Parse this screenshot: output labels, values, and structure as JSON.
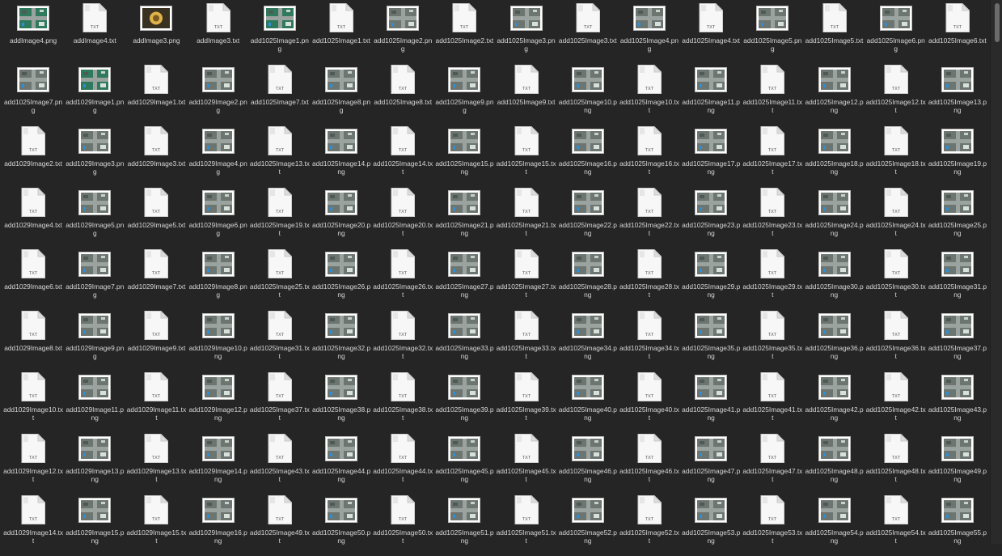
{
  "window": {
    "view": "icon-grid"
  },
  "colors": {
    "background": "#252525",
    "label": "#d6d6d6",
    "txt_badge": "#ffffff"
  },
  "icons": {
    "png": "image-file-icon",
    "txt": "text-file-icon",
    "txt_badge": "TXT"
  },
  "files": [
    {
      "label": "addImage4.png",
      "type": "png"
    },
    {
      "label": "addImage4.txt",
      "type": "txt"
    },
    {
      "label": "addImage3.png",
      "type": "png"
    },
    {
      "label": "addImage3.txt",
      "type": "txt"
    },
    {
      "label": "add1025Image1.png",
      "type": "png"
    },
    {
      "label": "add1025Image1.txt",
      "type": "txt"
    },
    {
      "label": "add1025Image2.png",
      "type": "png"
    },
    {
      "label": "add1025Image2.txt",
      "type": "txt"
    },
    {
      "label": "add1025Image3.png",
      "type": "png"
    },
    {
      "label": "add1025Image3.txt",
      "type": "txt"
    },
    {
      "label": "add1025Image4.png",
      "type": "png"
    },
    {
      "label": "add1025Image4.txt",
      "type": "txt"
    },
    {
      "label": "add1025Image5.png",
      "type": "png"
    },
    {
      "label": "add1025Image5.txt",
      "type": "txt"
    },
    {
      "label": "add1025Image6.png",
      "type": "png"
    },
    {
      "label": "add1025Image6.txt",
      "type": "txt"
    },
    {
      "label": "add1025Image7.png",
      "type": "png"
    },
    {
      "label": "add1029Image1.png",
      "type": "png"
    },
    {
      "label": "add1029Image1.txt",
      "type": "txt"
    },
    {
      "label": "add1029Image2.png",
      "type": "png"
    },
    {
      "label": "add1025Image7.txt",
      "type": "txt"
    },
    {
      "label": "add1025Image8.png",
      "type": "png"
    },
    {
      "label": "add1025Image8.txt",
      "type": "txt"
    },
    {
      "label": "add1025Image9.png",
      "type": "png"
    },
    {
      "label": "add1025Image9.txt",
      "type": "txt"
    },
    {
      "label": "add1025Image10.png",
      "type": "png"
    },
    {
      "label": "add1025Image10.txt",
      "type": "txt"
    },
    {
      "label": "add1025Image11.png",
      "type": "png"
    },
    {
      "label": "add1025Image11.txt",
      "type": "txt"
    },
    {
      "label": "add1025Image12.png",
      "type": "png"
    },
    {
      "label": "add1025Image12.txt",
      "type": "txt"
    },
    {
      "label": "add1025Image13.png",
      "type": "png"
    },
    {
      "label": "add1029Image2.txt",
      "type": "txt"
    },
    {
      "label": "add1029Image3.png",
      "type": "png"
    },
    {
      "label": "add1029Image3.txt",
      "type": "txt"
    },
    {
      "label": "add1029Image4.png",
      "type": "png"
    },
    {
      "label": "add1025Image13.txt",
      "type": "txt"
    },
    {
      "label": "add1025Image14.png",
      "type": "png"
    },
    {
      "label": "add1025Image14.txt",
      "type": "txt"
    },
    {
      "label": "add1025Image15.png",
      "type": "png"
    },
    {
      "label": "add1025Image15.txt",
      "type": "txt"
    },
    {
      "label": "add1025Image16.png",
      "type": "png"
    },
    {
      "label": "add1025Image16.txt",
      "type": "txt"
    },
    {
      "label": "add1025Image17.png",
      "type": "png"
    },
    {
      "label": "add1025Image17.txt",
      "type": "txt"
    },
    {
      "label": "add1025Image18.png",
      "type": "png"
    },
    {
      "label": "add1025Image18.txt",
      "type": "txt"
    },
    {
      "label": "add1025Image19.png",
      "type": "png"
    },
    {
      "label": "add1029Image4.txt",
      "type": "txt"
    },
    {
      "label": "add1029Image5.png",
      "type": "png"
    },
    {
      "label": "add1029Image5.txt",
      "type": "txt"
    },
    {
      "label": "add1029Image6.png",
      "type": "png"
    },
    {
      "label": "add1025Image19.txt",
      "type": "txt"
    },
    {
      "label": "add1025Image20.png",
      "type": "png"
    },
    {
      "label": "add1025Image20.txt",
      "type": "txt"
    },
    {
      "label": "add1025Image21.png",
      "type": "png"
    },
    {
      "label": "add1025Image21.txt",
      "type": "txt"
    },
    {
      "label": "add1025Image22.png",
      "type": "png"
    },
    {
      "label": "add1025Image22.txt",
      "type": "txt"
    },
    {
      "label": "add1025Image23.png",
      "type": "png"
    },
    {
      "label": "add1025Image23.txt",
      "type": "txt"
    },
    {
      "label": "add1025Image24.png",
      "type": "png"
    },
    {
      "label": "add1025Image24.txt",
      "type": "txt"
    },
    {
      "label": "add1025Image25.png",
      "type": "png"
    },
    {
      "label": "add1029Image6.txt",
      "type": "txt"
    },
    {
      "label": "add1029Image7.png",
      "type": "png"
    },
    {
      "label": "add1029Image7.txt",
      "type": "txt"
    },
    {
      "label": "add1029Image8.png",
      "type": "png"
    },
    {
      "label": "add1025Image25.txt",
      "type": "txt"
    },
    {
      "label": "add1025Image26.png",
      "type": "png"
    },
    {
      "label": "add1025Image26.txt",
      "type": "txt"
    },
    {
      "label": "add1025Image27.png",
      "type": "png"
    },
    {
      "label": "add1025Image27.txt",
      "type": "txt"
    },
    {
      "label": "add1025Image28.png",
      "type": "png"
    },
    {
      "label": "add1025Image28.txt",
      "type": "txt"
    },
    {
      "label": "add1025Image29.png",
      "type": "png"
    },
    {
      "label": "add1025Image29.txt",
      "type": "txt"
    },
    {
      "label": "add1025Image30.png",
      "type": "png"
    },
    {
      "label": "add1025Image30.txt",
      "type": "txt"
    },
    {
      "label": "add1025Image31.png",
      "type": "png"
    },
    {
      "label": "add1029Image8.txt",
      "type": "txt"
    },
    {
      "label": "add1029Image9.png",
      "type": "png"
    },
    {
      "label": "add1029Image9.txt",
      "type": "txt"
    },
    {
      "label": "add1029Image10.png",
      "type": "png"
    },
    {
      "label": "add1025Image31.txt",
      "type": "txt"
    },
    {
      "label": "add1025Image32.png",
      "type": "png"
    },
    {
      "label": "add1025Image32.txt",
      "type": "txt"
    },
    {
      "label": "add1025Image33.png",
      "type": "png"
    },
    {
      "label": "add1025Image33.txt",
      "type": "txt"
    },
    {
      "label": "add1025Image34.png",
      "type": "png"
    },
    {
      "label": "add1025Image34.txt",
      "type": "txt"
    },
    {
      "label": "add1025Image35.png",
      "type": "png"
    },
    {
      "label": "add1025Image35.txt",
      "type": "txt"
    },
    {
      "label": "add1025Image36.png",
      "type": "png"
    },
    {
      "label": "add1025Image36.txt",
      "type": "txt"
    },
    {
      "label": "add1025Image37.png",
      "type": "png"
    },
    {
      "label": "add1029Image10.txt",
      "type": "txt"
    },
    {
      "label": "add1029Image11.png",
      "type": "png"
    },
    {
      "label": "add1029Image11.txt",
      "type": "txt"
    },
    {
      "label": "add1029Image12.png",
      "type": "png"
    },
    {
      "label": "add1025Image37.txt",
      "type": "txt"
    },
    {
      "label": "add1025Image38.png",
      "type": "png"
    },
    {
      "label": "add1025Image38.txt",
      "type": "txt"
    },
    {
      "label": "add1025Image39.png",
      "type": "png"
    },
    {
      "label": "add1025Image39.txt",
      "type": "txt"
    },
    {
      "label": "add1025Image40.png",
      "type": "png"
    },
    {
      "label": "add1025Image40.txt",
      "type": "txt"
    },
    {
      "label": "add1025Image41.png",
      "type": "png"
    },
    {
      "label": "add1025Image41.txt",
      "type": "txt"
    },
    {
      "label": "add1025Image42.png",
      "type": "png"
    },
    {
      "label": "add1025Image42.txt",
      "type": "txt"
    },
    {
      "label": "add1025Image43.png",
      "type": "png"
    },
    {
      "label": "add1029Image12.txt",
      "type": "txt"
    },
    {
      "label": "add1029Image13.png",
      "type": "png"
    },
    {
      "label": "add1029Image13.txt",
      "type": "txt"
    },
    {
      "label": "add1029Image14.png",
      "type": "png"
    },
    {
      "label": "add1025Image43.txt",
      "type": "txt"
    },
    {
      "label": "add1025Image44.png",
      "type": "png"
    },
    {
      "label": "add1025Image44.txt",
      "type": "txt"
    },
    {
      "label": "add1025Image45.png",
      "type": "png"
    },
    {
      "label": "add1025Image45.txt",
      "type": "txt"
    },
    {
      "label": "add1025Image46.png",
      "type": "png"
    },
    {
      "label": "add1025Image46.txt",
      "type": "txt"
    },
    {
      "label": "add1025Image47.png",
      "type": "png"
    },
    {
      "label": "add1025Image47.txt",
      "type": "txt"
    },
    {
      "label": "add1025Image48.png",
      "type": "png"
    },
    {
      "label": "add1025Image48.txt",
      "type": "txt"
    },
    {
      "label": "add1025Image49.png",
      "type": "png"
    },
    {
      "label": "add1029Image14.txt",
      "type": "txt"
    },
    {
      "label": "add1029Image15.png",
      "type": "png"
    },
    {
      "label": "add1029Image15.txt",
      "type": "txt"
    },
    {
      "label": "add1029Image16.png",
      "type": "png"
    },
    {
      "label": "add1025Image49.txt",
      "type": "txt"
    },
    {
      "label": "add1025Image50.png",
      "type": "png"
    },
    {
      "label": "add1025Image50.txt",
      "type": "txt"
    },
    {
      "label": "add1025Image51.png",
      "type": "png"
    },
    {
      "label": "add1025Image51.txt",
      "type": "txt"
    },
    {
      "label": "add1025Image52.png",
      "type": "png"
    },
    {
      "label": "add1025Image52.txt",
      "type": "txt"
    },
    {
      "label": "add1025Image53.png",
      "type": "png"
    },
    {
      "label": "add1025Image53.txt",
      "type": "txt"
    },
    {
      "label": "add1025Image54.png",
      "type": "png"
    },
    {
      "label": "add1025Image54.txt",
      "type": "txt"
    },
    {
      "label": "add1025Image55.png",
      "type": "png"
    }
  ]
}
